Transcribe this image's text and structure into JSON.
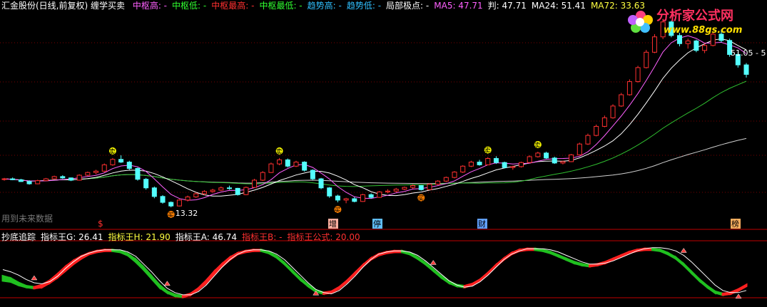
{
  "header": {
    "title": "汇金股份(日线,前复权) 缠学买卖",
    "items": [
      {
        "label": "中枢高: -",
        "color": "#ff60ff"
      },
      {
        "label": "中枢低: -",
        "color": "#30ff30"
      },
      {
        "label": "中枢最高: -",
        "color": "#ff3030"
      },
      {
        "label": "中枢最低: -",
        "color": "#30ff30"
      },
      {
        "label": "趋势高: -",
        "color": "#30c0ff"
      },
      {
        "label": "趋势低: -",
        "color": "#30c0ff"
      },
      {
        "label": "局部极点: -",
        "color": "#ffffff"
      },
      {
        "label": "MA5: 47.71",
        "color": "#ff60ff"
      },
      {
        "label": "判: 47.71",
        "color": "#ffffff"
      },
      {
        "label": "MA24: 51.41",
        "color": "#ffffff"
      },
      {
        "label": "MA72: 33.63",
        "color": "#ffff40"
      }
    ]
  },
  "sub_header": {
    "items": [
      {
        "label": "抄底追踪",
        "color": "#ffffff"
      },
      {
        "label": "指标王G: 26.41",
        "color": "#ffffff"
      },
      {
        "label": "指标王H: 21.90",
        "color": "#ffff40"
      },
      {
        "label": "指标王A: 46.74",
        "color": "#ffffff"
      },
      {
        "label": "指标王B: -",
        "color": "#ff3030"
      },
      {
        "label": "指标王公式: 20.00",
        "color": "#ff3030"
      }
    ]
  },
  "logo": {
    "name": "分析家公式网",
    "url": "www.88gs.com"
  },
  "watermark": "用到未来数据",
  "annotations": {
    "low_price": "13.32",
    "high_price": "51.05 - 5",
    "buy_mark": "买",
    "sell_mark": "卖",
    "s_mark": "$"
  },
  "tags": [
    {
      "text": "增",
      "bg": "#ffb0a0",
      "color": "#000"
    },
    {
      "text": "停",
      "bg": "#60c0ff",
      "color": "#000"
    },
    {
      "text": "财",
      "bg": "#60a0ff",
      "color": "#000"
    },
    {
      "text": "榜",
      "bg": "#ffb060",
      "color": "#000"
    }
  ],
  "colors": {
    "up": "#ff3030",
    "down": "#54ffff",
    "ma5": "#ff60ff",
    "ma_white": "#ffffff",
    "ma_green": "#30c030",
    "ma72": "#d0d0d0",
    "grid": "#7a0000",
    "osc_red": "#ff2020",
    "osc_green": "#20c020"
  },
  "chart_data": [
    {
      "type": "candlestick",
      "title": "汇金股份(日线,前复权)",
      "ylim": [
        10,
        56
      ],
      "candles": [
        [
          19.5,
          19.8,
          19.2,
          19.6
        ],
        [
          19.6,
          19.9,
          19.3,
          19.4
        ],
        [
          19.4,
          19.6,
          18.9,
          19.0
        ],
        [
          19.0,
          19.3,
          18.3,
          18.5
        ],
        [
          18.5,
          19.4,
          18.4,
          19.2
        ],
        [
          19.2,
          19.8,
          19.1,
          19.6
        ],
        [
          19.6,
          20.3,
          19.5,
          20.1
        ],
        [
          20.1,
          20.4,
          19.6,
          19.8
        ],
        [
          19.8,
          19.9,
          19.1,
          19.3
        ],
        [
          19.3,
          20.6,
          19.2,
          20.4
        ],
        [
          20.4,
          21.2,
          20.2,
          21.0
        ],
        [
          21.0,
          21.6,
          20.6,
          21.3
        ],
        [
          21.3,
          23.0,
          21.1,
          22.7
        ],
        [
          22.7,
          24.2,
          22.5,
          23.9
        ],
        [
          23.9,
          24.8,
          23.1,
          23.3
        ],
        [
          23.3,
          23.6,
          21.6,
          21.9
        ],
        [
          21.9,
          22.1,
          19.2,
          19.5
        ],
        [
          19.5,
          19.8,
          17.2,
          17.6
        ],
        [
          17.6,
          17.9,
          15.3,
          15.7
        ],
        [
          15.7,
          16.0,
          14.1,
          14.4
        ],
        [
          14.4,
          14.6,
          13.3,
          13.6
        ],
        [
          13.6,
          15.1,
          13.5,
          14.9
        ],
        [
          14.9,
          15.9,
          14.6,
          15.6
        ],
        [
          15.6,
          16.6,
          15.4,
          16.3
        ],
        [
          16.3,
          17.1,
          16.0,
          16.8
        ],
        [
          16.8,
          17.4,
          16.5,
          17.1
        ],
        [
          17.1,
          17.9,
          16.9,
          17.6
        ],
        [
          17.6,
          18.1,
          17.2,
          17.5
        ],
        [
          17.5,
          17.6,
          15.9,
          16.1
        ],
        [
          16.1,
          17.9,
          16.0,
          17.7
        ],
        [
          17.7,
          19.6,
          17.6,
          19.3
        ],
        [
          19.3,
          21.3,
          19.1,
          21.0
        ],
        [
          21.0,
          23.2,
          20.9,
          22.9
        ],
        [
          22.9,
          24.2,
          22.6,
          23.8
        ],
        [
          23.8,
          24.1,
          22.1,
          22.4
        ],
        [
          22.4,
          23.6,
          22.2,
          23.3
        ],
        [
          23.3,
          23.5,
          21.2,
          21.5
        ],
        [
          21.5,
          21.7,
          19.3,
          19.6
        ],
        [
          19.6,
          19.8,
          17.3,
          17.6
        ],
        [
          17.6,
          17.8,
          15.4,
          15.8
        ],
        [
          15.8,
          16.1,
          14.4,
          14.9
        ],
        [
          14.9,
          15.4,
          14.2,
          15.2
        ],
        [
          15.2,
          15.6,
          14.4,
          14.6
        ],
        [
          14.6,
          16.3,
          14.5,
          16.1
        ],
        [
          16.1,
          16.4,
          15.2,
          15.5
        ],
        [
          15.5,
          16.9,
          15.4,
          16.7
        ],
        [
          16.7,
          17.3,
          16.4,
          16.9
        ],
        [
          16.9,
          17.6,
          16.6,
          17.3
        ],
        [
          17.3,
          17.9,
          17.1,
          17.7
        ],
        [
          17.7,
          18.4,
          17.4,
          18.1
        ],
        [
          18.1,
          18.2,
          17.0,
          17.2
        ],
        [
          17.2,
          18.6,
          17.1,
          18.4
        ],
        [
          18.4,
          19.3,
          18.2,
          19.1
        ],
        [
          19.1,
          20.1,
          18.9,
          19.9
        ],
        [
          19.9,
          21.3,
          19.7,
          21.1
        ],
        [
          21.1,
          22.6,
          20.9,
          22.4
        ],
        [
          22.4,
          23.6,
          22.2,
          23.3
        ],
        [
          23.3,
          23.8,
          22.5,
          22.7
        ],
        [
          22.7,
          24.4,
          22.6,
          24.1
        ],
        [
          24.1,
          24.6,
          22.9,
          23.2
        ],
        [
          23.2,
          23.4,
          21.9,
          22.1
        ],
        [
          22.1,
          22.5,
          21.6,
          22.3
        ],
        [
          22.3,
          23.4,
          22.1,
          23.2
        ],
        [
          23.2,
          24.8,
          23.1,
          24.5
        ],
        [
          24.5,
          25.6,
          24.3,
          25.3
        ],
        [
          25.3,
          25.6,
          24.0,
          24.2
        ],
        [
          24.2,
          24.5,
          22.9,
          23.1
        ],
        [
          23.1,
          23.6,
          22.8,
          23.4
        ],
        [
          23.4,
          25.1,
          23.3,
          24.9
        ],
        [
          24.9,
          27.6,
          24.8,
          27.3
        ],
        [
          27.3,
          29.6,
          27.1,
          29.2
        ],
        [
          29.2,
          31.6,
          29.0,
          31.2
        ],
        [
          31.2,
          33.6,
          31.0,
          33.1
        ],
        [
          33.1,
          36.1,
          32.9,
          35.7
        ],
        [
          35.7,
          38.6,
          35.5,
          38.2
        ],
        [
          38.2,
          41.6,
          38.0,
          41.1
        ],
        [
          41.1,
          44.6,
          40.9,
          44.2
        ],
        [
          44.2,
          48.1,
          44.0,
          47.6
        ],
        [
          47.6,
          51.6,
          47.4,
          51.0
        ],
        [
          51.0,
          55.0,
          50.5,
          54.3
        ],
        [
          54.3,
          54.6,
          50.9,
          51.3
        ],
        [
          51.3,
          51.9,
          48.9,
          49.5
        ],
        [
          49.5,
          50.6,
          48.4,
          50.1
        ],
        [
          50.1,
          50.4,
          47.6,
          48.0
        ],
        [
          48.0,
          49.6,
          47.4,
          49.1
        ],
        [
          49.1,
          52.1,
          48.9,
          51.6
        ],
        [
          51.6,
          52.6,
          49.8,
          50.2
        ],
        [
          50.2,
          50.6,
          46.6,
          47.1
        ],
        [
          47.1,
          47.6,
          44.2,
          44.8
        ],
        [
          44.8,
          45.2,
          42.0,
          42.7
        ]
      ]
    },
    {
      "type": "area",
      "title": "抄底追踪",
      "ylim": [
        0,
        100
      ],
      "series": [
        {
          "name": "指标王G",
          "values": [
            38,
            34,
            26,
            20,
            18,
            22,
            30,
            42,
            55,
            66,
            74,
            80,
            84,
            86,
            86,
            84,
            78,
            68,
            54,
            38,
            22,
            10,
            4,
            2,
            6,
            16,
            30,
            46,
            60,
            72,
            80,
            84,
            86,
            86,
            82,
            74,
            62,
            48,
            34,
            22,
            12,
            8,
            10,
            18,
            30,
            44,
            58,
            70,
            78,
            82,
            84,
            84,
            80,
            72,
            62,
            50,
            38,
            28,
            22,
            20,
            24,
            32,
            44,
            58,
            70,
            80,
            86,
            88,
            88,
            86,
            82,
            76,
            70,
            64,
            60,
            58,
            60,
            64,
            70,
            76,
            82,
            86,
            88,
            88,
            86,
            80,
            72,
            60,
            46,
            32,
            20,
            10,
            6,
            8,
            14,
            22
          ]
        },
        {
          "name": "指标王A",
          "values": [
            30,
            28,
            22,
            18,
            16,
            18,
            26,
            36,
            48,
            60,
            70,
            78,
            82,
            84,
            84,
            82,
            76,
            64,
            50,
            34,
            18,
            8,
            2,
            0,
            4,
            14,
            26,
            42,
            56,
            68,
            78,
            82,
            84,
            84,
            80,
            72,
            60,
            46,
            32,
            20,
            10,
            6,
            8,
            16,
            28,
            42,
            56,
            68,
            76,
            80,
            82,
            82,
            78,
            70,
            60,
            48,
            36,
            26,
            20,
            18,
            22,
            30,
            42,
            56,
            68,
            78,
            84,
            86,
            86,
            84,
            80,
            74,
            68,
            62,
            58,
            56,
            58,
            62,
            68,
            74,
            80,
            84,
            86,
            86,
            84,
            78,
            70,
            58,
            44,
            30,
            18,
            8,
            4,
            6,
            12,
            20
          ]
        },
        {
          "name": "指标王H",
          "values": [
            50,
            46,
            40,
            32,
            26,
            24,
            28,
            38,
            52,
            64,
            74,
            80,
            84,
            86,
            86,
            86,
            82,
            74,
            60,
            46,
            30,
            16,
            8,
            4,
            4,
            10,
            22,
            38,
            54,
            68,
            78,
            84,
            86,
            86,
            84,
            78,
            68,
            54,
            40,
            26,
            14,
            8,
            6,
            12,
            24,
            38,
            54,
            68,
            78,
            82,
            84,
            84,
            82,
            76,
            66,
            54,
            42,
            30,
            22,
            18,
            20,
            28,
            40,
            54,
            68,
            78,
            84,
            88,
            88,
            88,
            86,
            82,
            76,
            70,
            64,
            60,
            60,
            62,
            66,
            72,
            78,
            84,
            88,
            90,
            90,
            88,
            84,
            76,
            64,
            50,
            36,
            22,
            12,
            8,
            8,
            12
          ]
        }
      ]
    }
  ]
}
